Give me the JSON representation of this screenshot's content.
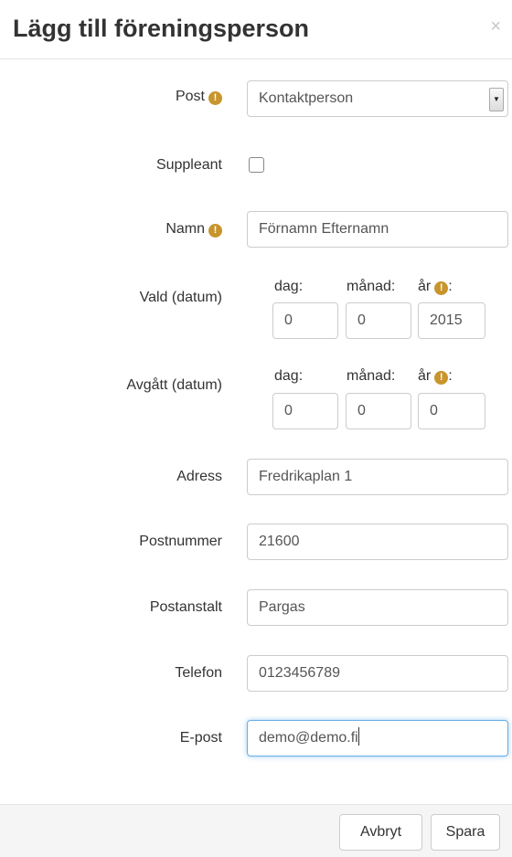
{
  "modal": {
    "title": "Lägg till föreningsperson",
    "close_glyph": "×"
  },
  "form": {
    "post": {
      "label": "Post",
      "value": "Kontaktperson",
      "has_warning": true
    },
    "suppleant": {
      "label": "Suppleant",
      "checked": false
    },
    "namn": {
      "label": "Namn",
      "placeholder": "Förnamn Efternamn",
      "has_warning": true
    },
    "vald": {
      "label": "Vald (datum)",
      "dag_label": "dag:",
      "manad_label": "månad:",
      "ar_label": "år",
      "dag": "0",
      "manad": "0",
      "ar": "2015"
    },
    "avgatt": {
      "label": "Avgått (datum)",
      "dag_label": "dag:",
      "manad_label": "månad:",
      "ar_label": "år",
      "dag": "0",
      "manad": "0",
      "ar": "0"
    },
    "adress": {
      "label": "Adress",
      "value": "Fredrikaplan 1"
    },
    "postnummer": {
      "label": "Postnummer",
      "value": "21600"
    },
    "postanstalt": {
      "label": "Postanstalt",
      "value": "Pargas"
    },
    "telefon": {
      "label": "Telefon",
      "value": "0123456789"
    },
    "epost": {
      "label": "E-post",
      "value": "demo@demo.fi"
    }
  },
  "footer": {
    "cancel_label": "Avbryt",
    "save_label": "Spara"
  },
  "icons": {
    "warning": "exclamation-circle-icon",
    "warning_color": "#c8952c",
    "focus_color": "#66afe9"
  }
}
